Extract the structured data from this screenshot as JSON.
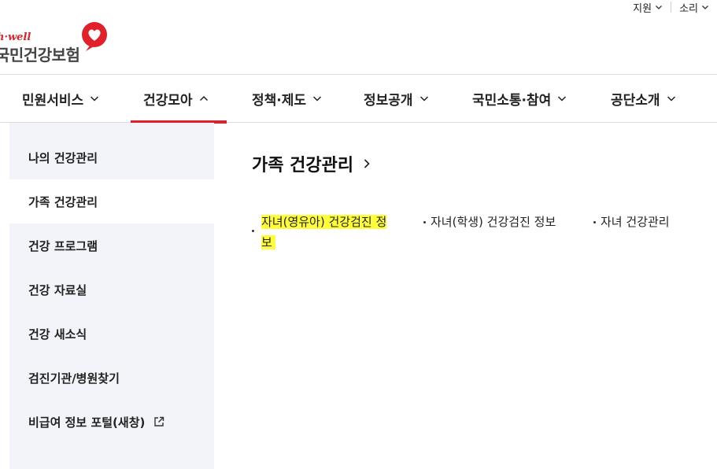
{
  "util": {
    "items": [
      {
        "label": "지원"
      },
      {
        "label": "소리"
      }
    ]
  },
  "logo": {
    "en": "h·well",
    "ko": "국민건강보험"
  },
  "gnb": {
    "items": [
      {
        "label": "민원서비스",
        "expanded": false
      },
      {
        "label": "건강모아",
        "expanded": true
      },
      {
        "label": "정책·제도",
        "expanded": false
      },
      {
        "label": "정보공개",
        "expanded": false
      },
      {
        "label": "국민소통·참여",
        "expanded": false
      },
      {
        "label": "공단소개",
        "expanded": false
      }
    ]
  },
  "lnb": {
    "items": [
      {
        "label": "나의 건강관리"
      },
      {
        "label": "가족 건강관리",
        "active": true
      },
      {
        "label": "건강 프로그램"
      },
      {
        "label": "건강 자료실"
      },
      {
        "label": "건강 새소식"
      },
      {
        "label": "검진기관/병원찾기"
      },
      {
        "label": "비급여 정보 포털(새창)"
      }
    ]
  },
  "content": {
    "title": "가족 건강관리",
    "links": [
      {
        "line1": "자녀(영유아) 건강검진 정",
        "line2": "보"
      },
      {
        "label": "자녀(학생) 건강검진 정보"
      },
      {
        "label": "자녀 건강관리"
      }
    ]
  },
  "colors": {
    "accent": "#e2202b",
    "highlight": "#fffd3a",
    "lnb_bg": "#f3f4f9"
  }
}
